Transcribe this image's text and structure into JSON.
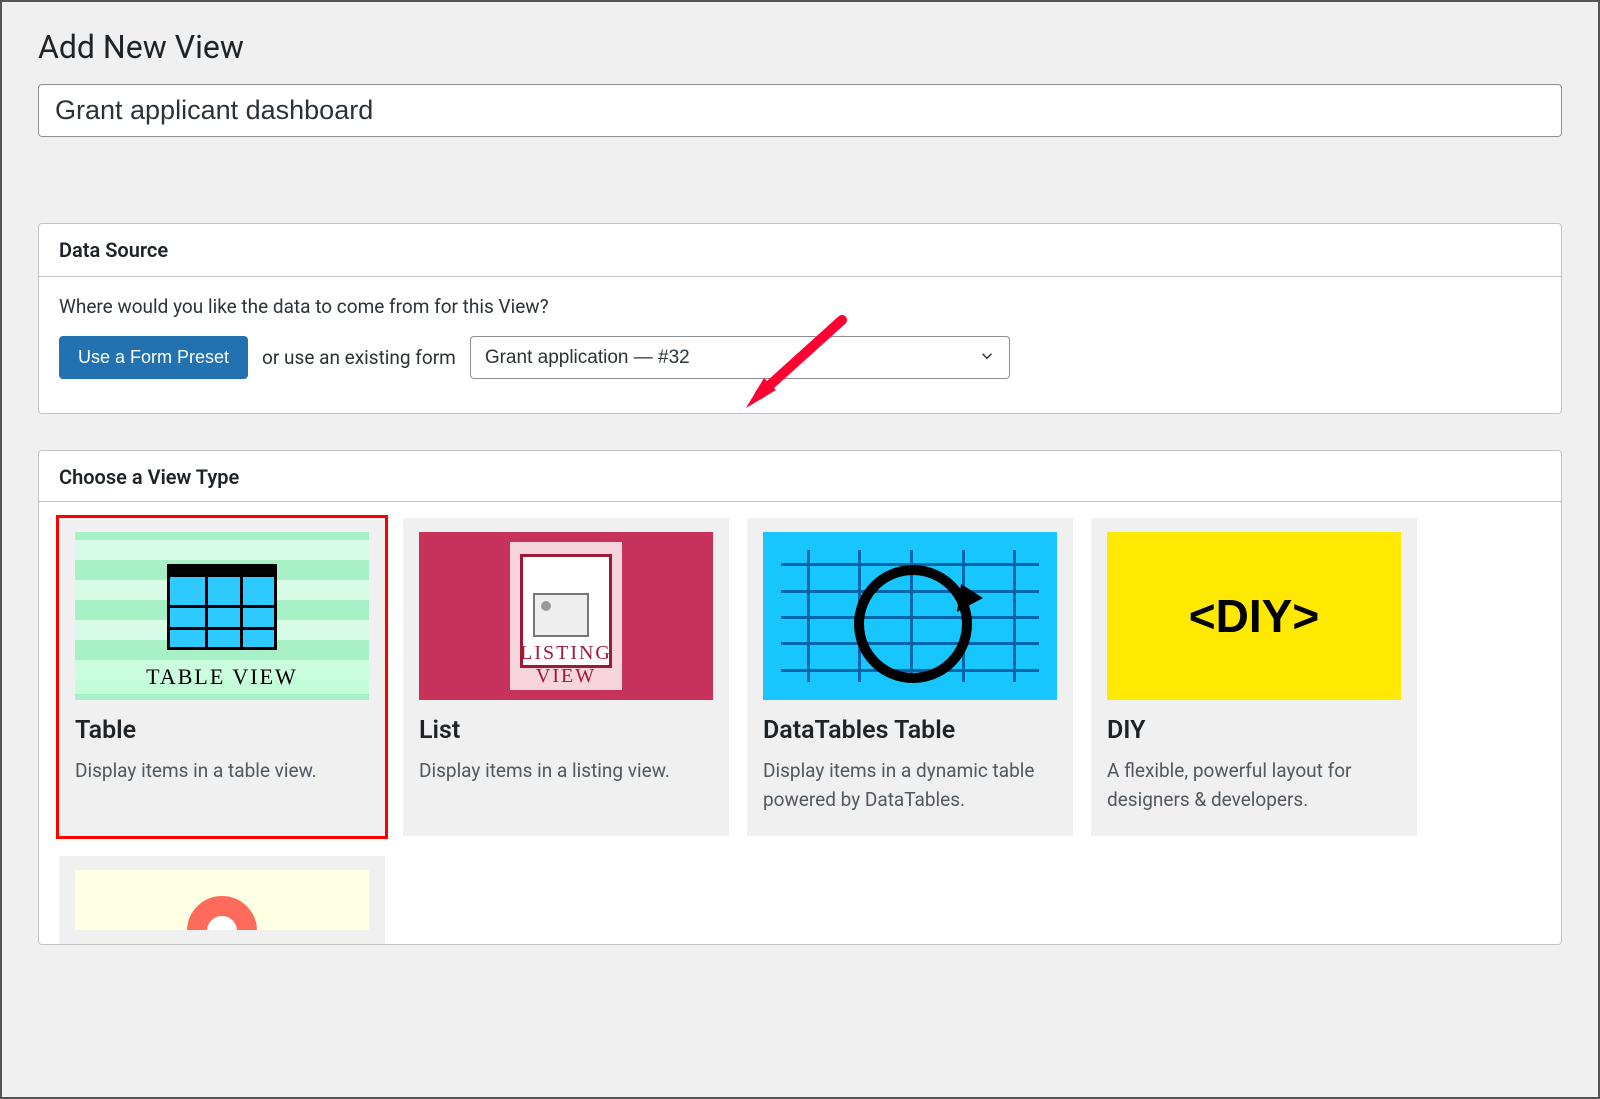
{
  "page_title": "Add New View",
  "title_input_value": "Grant applicant dashboard",
  "data_source": {
    "header": "Data Source",
    "prompt": "Where would you like the data to come from for this View?",
    "preset_button": "Use a Form Preset",
    "or_text": "or use an existing form",
    "selected_form": "Grant application — #32"
  },
  "view_type": {
    "header": "Choose a View Type",
    "cards": [
      {
        "key": "table",
        "title": "Table",
        "desc": "Display items in a table view.",
        "thumb_label": "TABLE VIEW",
        "selected": true
      },
      {
        "key": "list",
        "title": "List",
        "desc": "Display items in a listing view.",
        "thumb_label": "LISTING VIEW",
        "selected": false
      },
      {
        "key": "datatables",
        "title": "DataTables Table",
        "desc": "Display items in a dynamic table powered by DataTables.",
        "thumb_label": "",
        "selected": false
      },
      {
        "key": "diy",
        "title": "DIY",
        "desc": "A flexible, powerful layout for designers & developers.",
        "thumb_label": "<DIY>",
        "selected": false
      }
    ]
  }
}
